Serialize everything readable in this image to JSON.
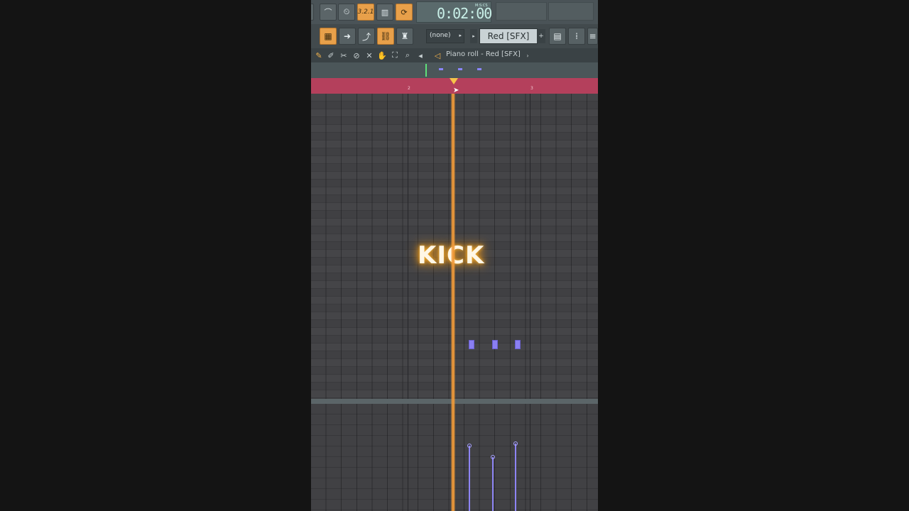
{
  "toolbar_top": {
    "time": "0:02:00",
    "time_unit": "M:S:CS",
    "buttons": [
      {
        "icon": "metronome-icon"
      },
      {
        "icon": "wait-record-icon"
      },
      {
        "icon": "countdown-icon",
        "label": "3.2.1"
      },
      {
        "icon": "step-edit-icon"
      },
      {
        "icon": "loop-record-icon"
      }
    ]
  },
  "toolbar_second": {
    "pattern_select": "(none)",
    "channel_name": "Red [SFX]"
  },
  "piano_roll": {
    "title": "Piano roll - Red [SFX]",
    "bar_labels": [
      "2",
      "3"
    ],
    "overlay_text": "KICK",
    "note_count": 3
  },
  "colors": {
    "accent": "#e8a04a",
    "timeline": "#b4405c",
    "note": "#8a7ff2",
    "playhead": "#f09a3a"
  }
}
